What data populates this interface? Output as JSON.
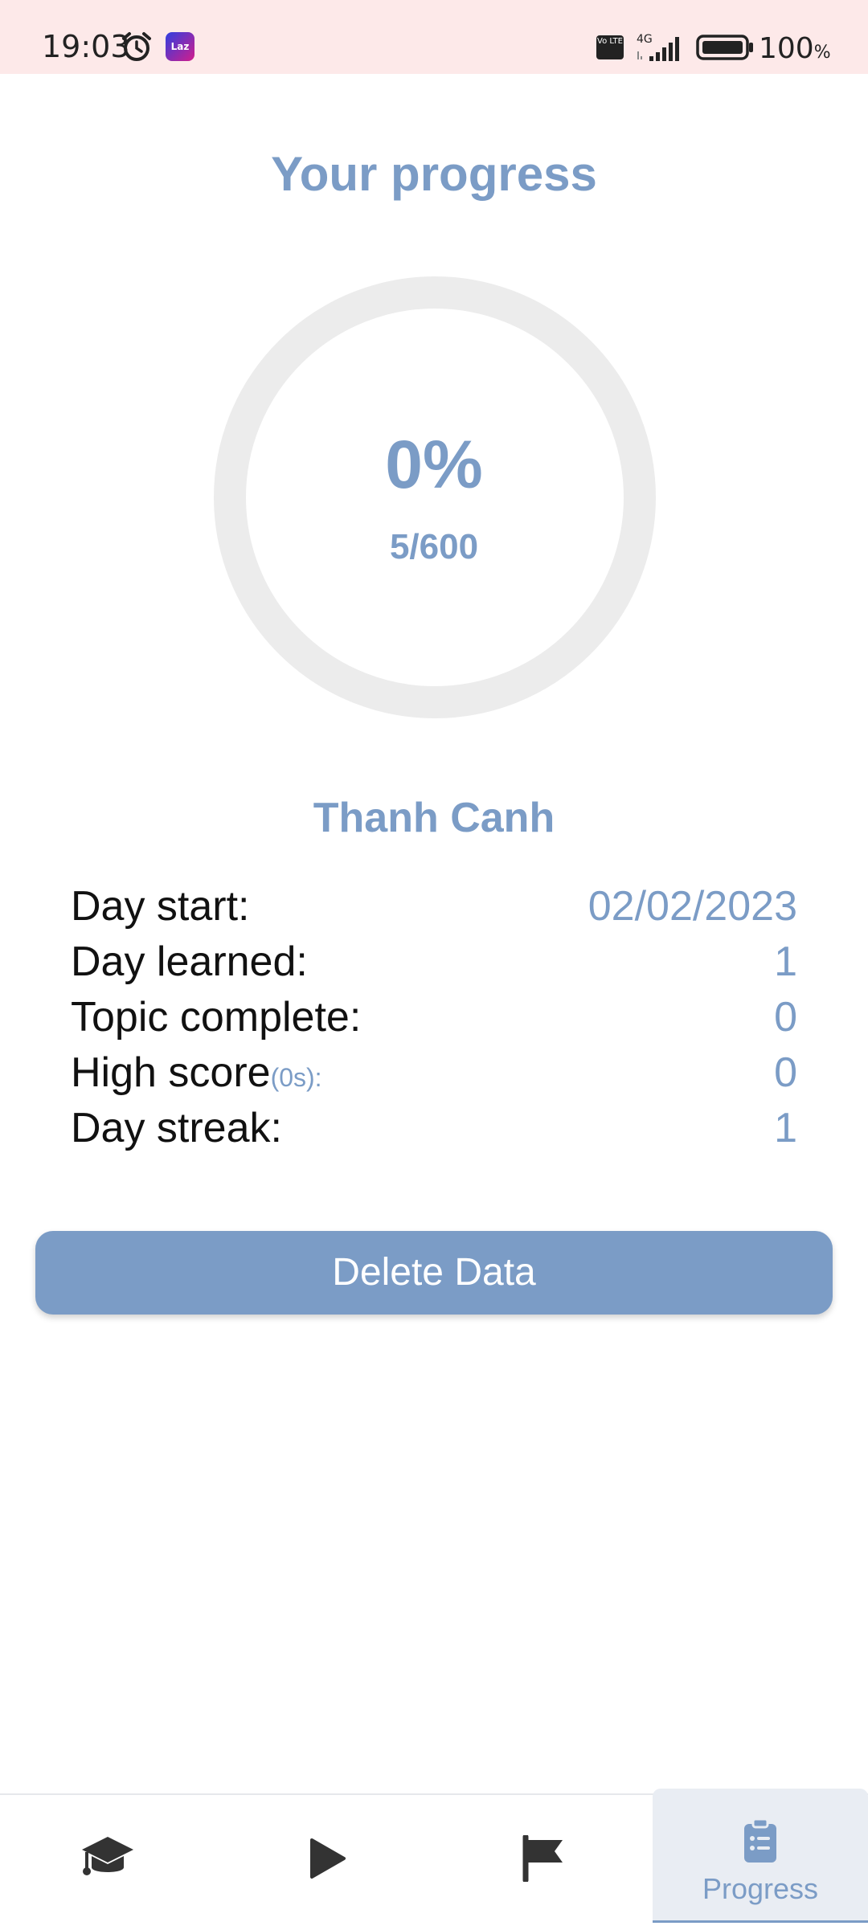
{
  "status_bar": {
    "time": "19:03",
    "app_badge": "Laz",
    "network": "4G",
    "volte": "Vo LTE",
    "battery_text": "100",
    "battery_unit": "%"
  },
  "header": {
    "title": "Your progress"
  },
  "progress": {
    "percent_text": "0%",
    "count_text": "5/600",
    "fraction": 0.0,
    "ring_color": "#ececec",
    "accent_color": "#7b9cc6"
  },
  "user": {
    "name": "Thanh Canh"
  },
  "stats": [
    {
      "label": "Day start:",
      "value": "02/02/2023"
    },
    {
      "label": "Day learned:",
      "value": "1"
    },
    {
      "label": "Topic complete:",
      "value": "0"
    },
    {
      "label": "High score",
      "sub": "(0s):",
      "value": "0"
    },
    {
      "label": "Day streak:",
      "value": "1"
    }
  ],
  "actions": {
    "delete_label": "Delete Data"
  },
  "bottom_nav": {
    "items": [
      {
        "icon": "graduation-cap-icon"
      },
      {
        "icon": "play-icon"
      },
      {
        "icon": "flag-icon"
      },
      {
        "icon": "clipboard-list-icon",
        "label": "Progress",
        "active": true
      }
    ]
  }
}
